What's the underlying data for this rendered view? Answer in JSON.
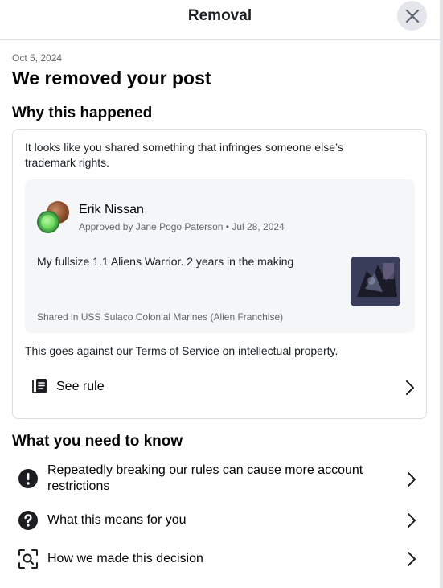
{
  "header": {
    "title": "Removal",
    "close_icon": "close-icon"
  },
  "notice": {
    "date": "Oct 5, 2024",
    "title": "We removed your post"
  },
  "why": {
    "heading": "Why this happened",
    "explanation": "It looks like you shared something that infringes someone else’s trademark rights.",
    "post": {
      "author": "Erik Nissan",
      "approved_line": "Approved by Jane Pogo Paterson • Jul 28, 2024",
      "text": "My fullsize 1.1 Aliens Warrior. 2 years in the making",
      "shared_in": "Shared in USS Sulaco Colonial Marines (Alien Franchise)"
    },
    "terms_line": "This goes against our Terms of Service on intellectual property.",
    "see_rule_label": "See rule",
    "see_rule_icon": "rulebook-icon"
  },
  "know": {
    "heading": "What you need to know",
    "items": [
      {
        "label": "Repeatedly breaking our rules can cause more account restrictions",
        "icon": "exclamation-circle-icon"
      },
      {
        "label": "What this means for you",
        "icon": "question-circle-icon"
      },
      {
        "label": "How we made this decision",
        "icon": "magnifier-scan-icon"
      }
    ]
  },
  "colors": {
    "text_primary": "#050505",
    "text_secondary": "#65676b",
    "divider": "#dadde1",
    "post_background": "#f5f6f7",
    "close_button_background": "#e4e6eb"
  }
}
